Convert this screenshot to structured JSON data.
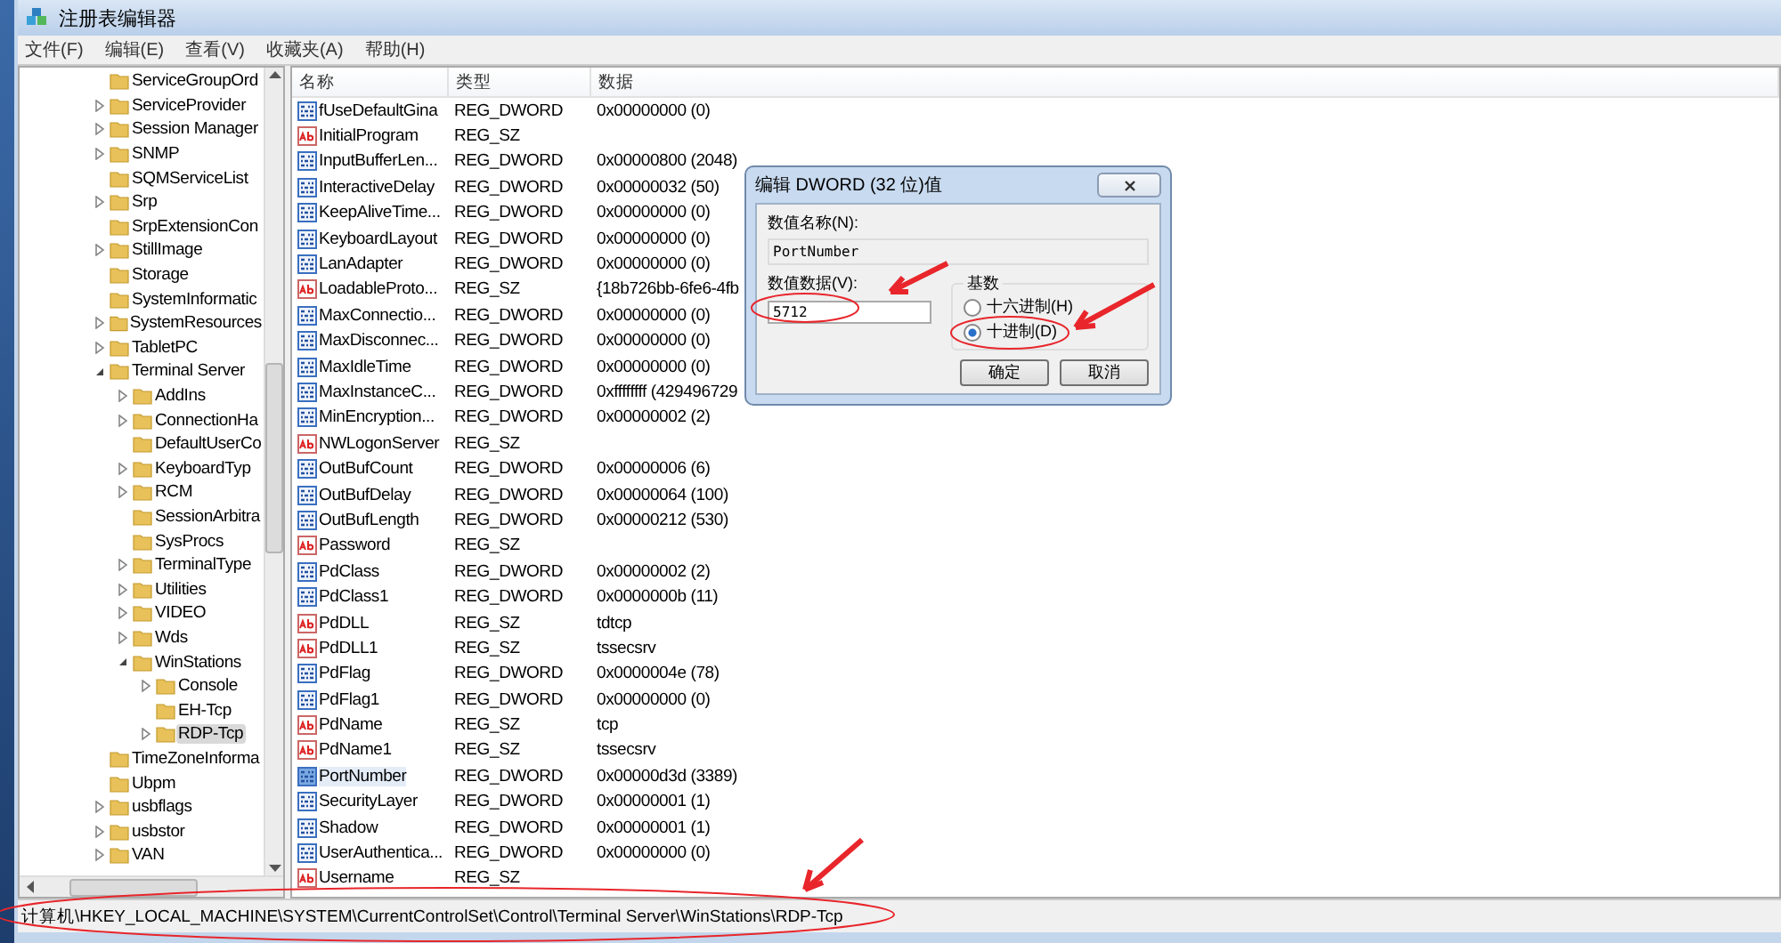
{
  "window": {
    "title": "注册表编辑器"
  },
  "menu": [
    "文件(F)",
    "编辑(E)",
    "查看(V)",
    "收藏夹(A)",
    "帮助(H)"
  ],
  "tree": [
    {
      "label": "ServiceGroupOrd",
      "expandable": false,
      "selected": false
    },
    {
      "label": "ServiceProvider",
      "expandable": true,
      "expanded": false,
      "selected": false
    },
    {
      "label": "Session Manager",
      "expandable": true,
      "expanded": false,
      "selected": false
    },
    {
      "label": "SNMP",
      "expandable": true,
      "expanded": false,
      "selected": false
    },
    {
      "label": "SQMServiceList",
      "expandable": false,
      "selected": false
    },
    {
      "label": "Srp",
      "expandable": true,
      "expanded": false,
      "selected": false
    },
    {
      "label": "SrpExtensionCon",
      "expandable": false,
      "selected": false
    },
    {
      "label": "StillImage",
      "expandable": true,
      "expanded": false,
      "selected": false
    },
    {
      "label": "Storage",
      "expandable": false,
      "selected": false
    },
    {
      "label": "SystemInformatic",
      "expandable": false,
      "selected": false
    },
    {
      "label": "SystemResources",
      "expandable": true,
      "expanded": false,
      "selected": false
    },
    {
      "label": "TabletPC",
      "expandable": true,
      "expanded": false,
      "selected": false
    },
    {
      "label": "Terminal Server",
      "expandable": true,
      "expanded": true,
      "selected": false,
      "children": [
        {
          "label": "AddIns",
          "expandable": true,
          "expanded": false,
          "selected": false
        },
        {
          "label": "ConnectionHa",
          "expandable": true,
          "expanded": false,
          "selected": false
        },
        {
          "label": "DefaultUserCo",
          "expandable": false,
          "selected": false
        },
        {
          "label": "KeyboardTyp",
          "expandable": true,
          "expanded": false,
          "selected": false
        },
        {
          "label": "RCM",
          "expandable": true,
          "expanded": false,
          "selected": false
        },
        {
          "label": "SessionArbitra",
          "expandable": false,
          "selected": false
        },
        {
          "label": "SysProcs",
          "expandable": false,
          "selected": false
        },
        {
          "label": "TerminalType",
          "expandable": true,
          "expanded": false,
          "selected": false
        },
        {
          "label": "Utilities",
          "expandable": true,
          "expanded": false,
          "selected": false
        },
        {
          "label": "VIDEO",
          "expandable": true,
          "expanded": false,
          "selected": false
        },
        {
          "label": "Wds",
          "expandable": true,
          "expanded": false,
          "selected": false
        },
        {
          "label": "WinStations",
          "expandable": true,
          "expanded": true,
          "selected": false,
          "children": [
            {
              "label": "Console",
              "expandable": true,
              "expanded": false,
              "selected": false
            },
            {
              "label": "EH-Tcp",
              "expandable": false,
              "selected": false
            },
            {
              "label": "RDP-Tcp",
              "expandable": true,
              "expanded": false,
              "selected": true
            }
          ]
        }
      ]
    },
    {
      "label": "TimeZoneInforma",
      "expandable": false,
      "selected": false
    },
    {
      "label": "Ubpm",
      "expandable": false,
      "selected": false
    },
    {
      "label": "usbflags",
      "expandable": true,
      "expanded": false,
      "selected": false
    },
    {
      "label": "usbstor",
      "expandable": true,
      "expanded": false,
      "selected": false
    },
    {
      "label": "VAN",
      "expandable": true,
      "expanded": false,
      "selected": false
    }
  ],
  "table": {
    "columns": [
      "名称",
      "类型",
      "数据"
    ],
    "rows": [
      {
        "kind": "dword",
        "name": "fUseDefaultGina",
        "type": "REG_DWORD",
        "data": "0x00000000 (0)",
        "selected": false
      },
      {
        "kind": "string",
        "name": "InitialProgram",
        "type": "REG_SZ",
        "selected": false
      },
      {
        "kind": "dword",
        "name": "InputBufferLen...",
        "type": "REG_DWORD",
        "data": "0x00000800 (2048)",
        "selected": false
      },
      {
        "kind": "dword",
        "name": "InteractiveDelay",
        "type": "REG_DWORD",
        "data": "0x00000032 (50)",
        "selected": false
      },
      {
        "kind": "dword",
        "name": "KeepAliveTime...",
        "type": "REG_DWORD",
        "data": "0x00000000 (0)",
        "selected": false
      },
      {
        "kind": "dword",
        "name": "KeyboardLayout",
        "type": "REG_DWORD",
        "data": "0x00000000 (0)",
        "selected": false
      },
      {
        "kind": "dword",
        "name": "LanAdapter",
        "type": "REG_DWORD",
        "data": "0x00000000 (0)",
        "selected": false
      },
      {
        "kind": "string",
        "name": "LoadableProto...",
        "type": "REG_SZ",
        "data": "{18b726bb-6fe6-4fb",
        "selected": false
      },
      {
        "kind": "dword",
        "name": "MaxConnectio...",
        "type": "REG_DWORD",
        "data": "0x00000000 (0)",
        "selected": false
      },
      {
        "kind": "dword",
        "name": "MaxDisconnec...",
        "type": "REG_DWORD",
        "data": "0x00000000 (0)",
        "selected": false
      },
      {
        "kind": "dword",
        "name": "MaxIdleTime",
        "type": "REG_DWORD",
        "data": "0x00000000 (0)",
        "selected": false
      },
      {
        "kind": "dword",
        "name": "MaxInstanceC...",
        "type": "REG_DWORD",
        "data": "0xffffffff (429496729",
        "selected": false
      },
      {
        "kind": "dword",
        "name": "MinEncryption...",
        "type": "REG_DWORD",
        "data": "0x00000002 (2)",
        "selected": false
      },
      {
        "kind": "string",
        "name": "NWLogonServer",
        "type": "REG_SZ",
        "selected": false
      },
      {
        "kind": "dword",
        "name": "OutBufCount",
        "type": "REG_DWORD",
        "data": "0x00000006 (6)",
        "selected": false
      },
      {
        "kind": "dword",
        "name": "OutBufDelay",
        "type": "REG_DWORD",
        "data": "0x00000064 (100)",
        "selected": false
      },
      {
        "kind": "dword",
        "name": "OutBufLength",
        "type": "REG_DWORD",
        "data": "0x00000212 (530)",
        "selected": false
      },
      {
        "kind": "string",
        "name": "Password",
        "type": "REG_SZ",
        "selected": false
      },
      {
        "kind": "dword",
        "name": "PdClass",
        "type": "REG_DWORD",
        "data": "0x00000002 (2)",
        "selected": false
      },
      {
        "kind": "dword",
        "name": "PdClass1",
        "type": "REG_DWORD",
        "data": "0x0000000b (11)",
        "selected": false
      },
      {
        "kind": "string",
        "name": "PdDLL",
        "type": "REG_SZ",
        "data": "tdtcp",
        "selected": false
      },
      {
        "kind": "string",
        "name": "PdDLL1",
        "type": "REG_SZ",
        "data": "tssecsrv",
        "selected": false
      },
      {
        "kind": "dword",
        "name": "PdFlag",
        "type": "REG_DWORD",
        "data": "0x0000004e (78)",
        "selected": false
      },
      {
        "kind": "dword",
        "name": "PdFlag1",
        "type": "REG_DWORD",
        "data": "0x00000000 (0)",
        "selected": false
      },
      {
        "kind": "string",
        "name": "PdName",
        "type": "REG_SZ",
        "data": "tcp",
        "selected": false
      },
      {
        "kind": "string",
        "name": "PdName1",
        "type": "REG_SZ",
        "data": "tssecsrv",
        "selected": false
      },
      {
        "kind": "dword",
        "name": "PortNumber",
        "type": "REG_DWORD",
        "data": "0x00000d3d (3389)",
        "selected": true
      },
      {
        "kind": "dword",
        "name": "SecurityLayer",
        "type": "REG_DWORD",
        "data": "0x00000001 (1)",
        "selected": false
      },
      {
        "kind": "dword",
        "name": "Shadow",
        "type": "REG_DWORD",
        "data": "0x00000001 (1)",
        "selected": false
      },
      {
        "kind": "dword",
        "name": "UserAuthentica...",
        "type": "REG_DWORD",
        "data": "0x00000000 (0)",
        "selected": false
      },
      {
        "kind": "string",
        "name": "Username",
        "type": "REG_SZ",
        "selected": false
      }
    ]
  },
  "status_bar": "计算机\\HKEY_LOCAL_MACHINE\\SYSTEM\\CurrentControlSet\\Control\\Terminal Server\\WinStations\\RDP-Tcp",
  "dialog": {
    "title": "编辑 DWORD (32 位)值",
    "name_label": "数值名称(N):",
    "name_value": "PortNumber",
    "data_label": "数值数据(V):",
    "data_value": "5712",
    "base_label": "基数",
    "bases": [
      {
        "label": "十六进制(H)",
        "selected": false
      },
      {
        "label": "十进制(D)",
        "selected": true
      }
    ],
    "buttons": [
      "确定",
      "取消"
    ]
  },
  "annotations": [
    {
      "kind": "arrow"
    },
    {
      "kind": "ellipse"
    },
    {
      "kind": "arrow"
    },
    {
      "kind": "ellipse"
    },
    {
      "kind": "ellipse"
    },
    {
      "kind": "arrow"
    }
  ]
}
